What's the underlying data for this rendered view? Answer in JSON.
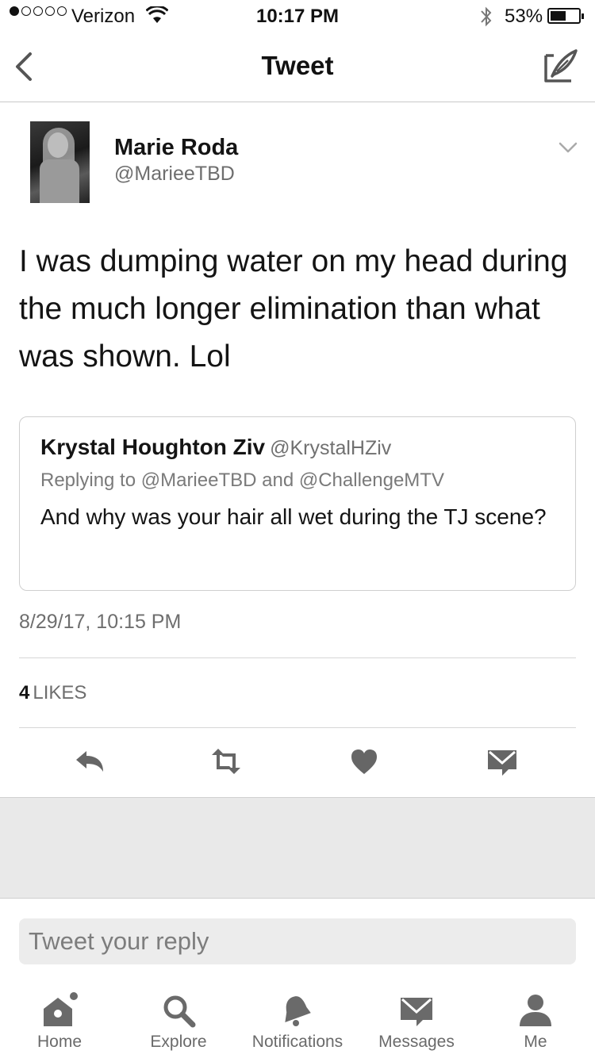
{
  "status_bar": {
    "carrier": "Verizon",
    "time": "10:17 PM",
    "battery": "53%"
  },
  "nav": {
    "title": "Tweet"
  },
  "tweet": {
    "author_name": "Marie Roda",
    "author_handle": "@MarieeTBD",
    "text": "I was dumping water on my head during the much longer elimination than what was shown. Lol",
    "timestamp": "8/29/17, 10:15 PM",
    "likes_count": "4",
    "likes_label": "LIKES"
  },
  "quoted_tweet": {
    "author_name": "Krystal Houghton Ziv",
    "author_handle": "@KrystalHZiv",
    "replying_to": "Replying to @MarieeTBD and @ChallengeMTV",
    "text": "And why was your hair all wet during the TJ scene?"
  },
  "reply": {
    "placeholder": "Tweet your reply"
  },
  "tabs": [
    {
      "label": "Home",
      "icon": "home-icon"
    },
    {
      "label": "Explore",
      "icon": "search-icon"
    },
    {
      "label": "Notifications",
      "icon": "bell-icon"
    },
    {
      "label": "Messages",
      "icon": "envelope-icon"
    },
    {
      "label": "Me",
      "icon": "person-icon"
    }
  ],
  "colors": {
    "text": "#141414",
    "muted": "#6e6e6e",
    "icon": "#6a6a6a",
    "divider": "#d6d6d6",
    "gray_area": "#e9e9e9"
  }
}
